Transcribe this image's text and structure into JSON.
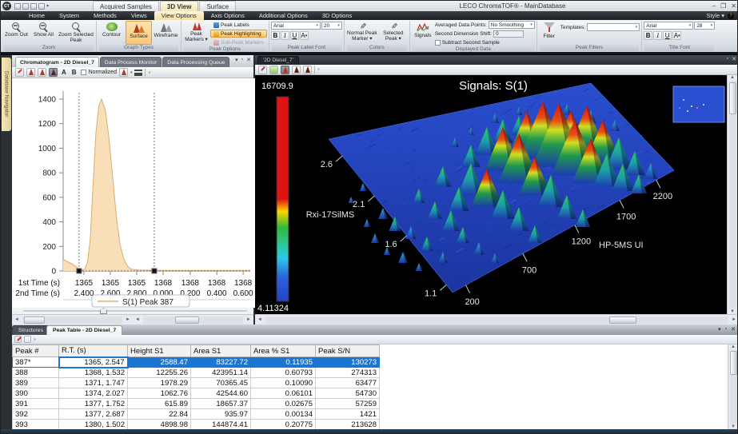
{
  "window": {
    "title": "LECO ChromaTOF® - MainDatabase",
    "style_label": "Style",
    "minimize": "–",
    "maximize": "❐",
    "close": "✕",
    "logo": "CT",
    "help": "?"
  },
  "doc_tabs": [
    {
      "label": "Acquired Samples",
      "active": false
    },
    {
      "label": "3D View",
      "active": true
    },
    {
      "label": "Surface",
      "active": false
    }
  ],
  "ribbon_tabs": [
    {
      "label": "Home",
      "active": false
    },
    {
      "label": "System",
      "active": false
    },
    {
      "label": "Methods",
      "active": false
    },
    {
      "label": "Views",
      "active": false
    },
    {
      "label": "View Options",
      "active": true
    },
    {
      "label": "Axis Options",
      "active": false
    },
    {
      "label": "Additional Options",
      "active": false
    },
    {
      "label": "3D Options",
      "active": false
    }
  ],
  "ribbon": {
    "zoom": {
      "caption": "Zoom",
      "buttons": [
        {
          "label": "Zoom Out"
        },
        {
          "label": "Show All"
        },
        {
          "label": "Zoom Selected Peak"
        }
      ]
    },
    "graph_types": {
      "caption": "Graph Types",
      "buttons": [
        {
          "label": "Contour",
          "active": false
        },
        {
          "label": "Surface",
          "active": true
        },
        {
          "label": "Wireframe",
          "active": false
        }
      ]
    },
    "peak_options": {
      "caption": "Peak Options",
      "marker_label": "Peak Markers",
      "toggles": [
        {
          "label": "Peak Labels",
          "state": "normal"
        },
        {
          "label": "Peak Highlighting",
          "state": "active"
        },
        {
          "label": "Sub-Peak Markers",
          "state": "disabled"
        }
      ]
    },
    "peak_label_font": {
      "caption": "Peak Label Font",
      "font": "Arial",
      "size": "20",
      "bold": "B",
      "italic": "I",
      "underline": "U",
      "color": "A"
    },
    "colors": {
      "caption": "Colors",
      "buttons": [
        {
          "label": "Normal Peak Marker"
        },
        {
          "label": "Selected Peak"
        }
      ]
    },
    "displayed_data": {
      "caption": "Displayed Data",
      "signals": "Signals",
      "avg_label": "Averaged Data Points:",
      "avg_value": "No Smoothing",
      "shift_label": "Second Dimension Shift:",
      "shift_value": "0",
      "subtract": "Subtract Second Sample"
    },
    "peak_filters": {
      "caption": "Peak Filters",
      "filter": "Filter",
      "templates_label": "Templates:",
      "templates_value": ""
    },
    "title_font": {
      "caption": "Title Font",
      "font": "Arial",
      "size": "28",
      "bold": "B",
      "italic": "I",
      "underline": "U",
      "color": "A"
    }
  },
  "left_rail": {
    "tab": "Database Navigator"
  },
  "chromatogram": {
    "tabs": [
      {
        "label": "Chromatogram - 2D Diesel_7",
        "active": true
      },
      {
        "label": "Data Process Monitor",
        "active": false
      },
      {
        "label": "Data Processing Queue",
        "active": false
      }
    ],
    "toolbar": {
      "a": "A",
      "b": "B",
      "normalized": "Normalized"
    },
    "chart_data": {
      "type": "area",
      "legend": "S(1) Peak 387",
      "ylim": [
        0,
        1500
      ],
      "yticks": [
        0,
        200,
        400,
        600,
        800,
        1000,
        1200,
        1400
      ],
      "x_row1_label": "1st Time (s)",
      "x_row2_label": "2nd Time (s)",
      "x_row1_ticks": [
        "1365",
        "1365",
        "1365",
        "1368",
        "1368",
        "1368",
        "1368"
      ],
      "x_row2_ticks": [
        "2.400",
        "2.600",
        "2.800",
        "0.000",
        "0.200",
        "0.400",
        "0.600"
      ],
      "tick_fracs": [
        0.111,
        0.252,
        0.393,
        0.534,
        0.679,
        0.821,
        0.962
      ],
      "curve": [
        [
          0,
          95
        ],
        [
          0.02,
          78
        ],
        [
          0.05,
          55
        ],
        [
          0.07,
          34
        ],
        [
          0.085,
          14
        ],
        [
          0.1,
          7
        ],
        [
          0.115,
          14
        ],
        [
          0.13,
          70
        ],
        [
          0.145,
          260
        ],
        [
          0.16,
          700
        ],
        [
          0.175,
          1120
        ],
        [
          0.19,
          1340
        ],
        [
          0.205,
          1400
        ],
        [
          0.225,
          1310
        ],
        [
          0.245,
          1080
        ],
        [
          0.265,
          760
        ],
        [
          0.285,
          430
        ],
        [
          0.305,
          205
        ],
        [
          0.325,
          92
        ],
        [
          0.345,
          36
        ],
        [
          0.365,
          14
        ],
        [
          0.4,
          7
        ],
        [
          0.487,
          6
        ],
        [
          0.6,
          4
        ],
        [
          0.8,
          4
        ],
        [
          1,
          5
        ]
      ],
      "marker_fracs": [
        0.085,
        0.487
      ],
      "fill_color": "#f8dfb8",
      "line_color": "#dcab70"
    }
  },
  "surface": {
    "tab": "'2D Diesel_7'",
    "chart_data": {
      "type": "surface",
      "title": "Signals: S(1)",
      "colorbar": {
        "max": "16709.9",
        "min": "4.11324"
      },
      "axis_left": {
        "label": "Rxi-17SilMS",
        "ticks": [
          "2.6",
          "2.1",
          "1.6",
          "1.1"
        ]
      },
      "axis_right": {
        "label": "HP-5MS UI",
        "ticks": [
          "200",
          "700",
          "1200",
          "1700",
          "2200"
        ]
      },
      "peaks": [
        [
          150,
          210,
          12,
          "t"
        ],
        [
          165,
          225,
          10,
          "t"
        ],
        [
          185,
          235,
          14,
          "t"
        ],
        [
          205,
          245,
          10,
          "t"
        ],
        [
          140,
          190,
          10,
          "t"
        ],
        [
          160,
          180,
          14,
          "t"
        ],
        [
          175,
          195,
          18,
          "g"
        ],
        [
          195,
          205,
          16,
          "t"
        ],
        [
          215,
          220,
          18,
          "g"
        ],
        [
          235,
          235,
          14,
          "t"
        ],
        [
          120,
          160,
          8,
          "t"
        ],
        [
          135,
          145,
          10,
          "t"
        ],
        [
          225,
          180,
          22,
          "g"
        ],
        [
          245,
          195,
          26,
          "g"
        ],
        [
          260,
          210,
          20,
          "g"
        ],
        [
          280,
          225,
          16,
          "t"
        ],
        [
          205,
          160,
          18,
          "g"
        ],
        [
          255,
          170,
          30,
          "g"
        ],
        [
          300,
          235,
          12,
          "t"
        ],
        [
          270,
          150,
          40,
          "g"
        ],
        [
          290,
          165,
          48,
          "r"
        ],
        [
          310,
          180,
          36,
          "g"
        ],
        [
          330,
          195,
          30,
          "g"
        ],
        [
          350,
          210,
          22,
          "g"
        ],
        [
          235,
          140,
          26,
          "g"
        ],
        [
          310,
          120,
          55,
          "r"
        ],
        [
          330,
          135,
          62,
          "r"
        ],
        [
          350,
          150,
          48,
          "r"
        ],
        [
          370,
          165,
          40,
          "g"
        ],
        [
          390,
          180,
          30,
          "g"
        ],
        [
          410,
          190,
          22,
          "g"
        ],
        [
          340,
          95,
          50,
          "r"
        ],
        [
          360,
          105,
          72,
          "r"
        ],
        [
          380,
          115,
          80,
          "r"
        ],
        [
          400,
          125,
          70,
          "r"
        ],
        [
          420,
          135,
          56,
          "r"
        ],
        [
          440,
          140,
          42,
          "g"
        ],
        [
          460,
          145,
          34,
          "g"
        ],
        [
          480,
          148,
          24,
          "g"
        ],
        [
          395,
          90,
          46,
          "r"
        ],
        [
          415,
          100,
          62,
          "r"
        ],
        [
          435,
          110,
          54,
          "r"
        ],
        [
          455,
          118,
          40,
          "g"
        ],
        [
          475,
          125,
          30,
          "g"
        ],
        [
          495,
          130,
          20,
          "t"
        ],
        [
          310,
          85,
          30,
          "g"
        ],
        [
          330,
          75,
          24,
          "g"
        ],
        [
          290,
          100,
          35,
          "g"
        ],
        [
          270,
          115,
          28,
          "g"
        ],
        [
          250,
          90,
          12,
          "t"
        ],
        [
          270,
          75,
          10,
          "t"
        ],
        [
          300,
          60,
          12,
          "t"
        ],
        [
          330,
          50,
          10,
          "t"
        ],
        [
          360,
          45,
          12,
          "t"
        ],
        [
          390,
          50,
          14,
          "t"
        ],
        [
          420,
          60,
          16,
          "t"
        ],
        [
          450,
          70,
          14,
          "t"
        ]
      ]
    }
  },
  "peak_table": {
    "tabs": [
      {
        "label": "Structures",
        "active": false
      },
      {
        "label": "Peak Table - 2D Diesel_7",
        "active": true
      }
    ],
    "chart_data": {
      "type": "table",
      "columns": [
        "Peak #",
        "R.T. (s)",
        "Height S1",
        "Area S1",
        "Area % S1",
        "Peak S/N"
      ],
      "rows": [
        [
          "387*",
          "1365, 2.547",
          "2588.47",
          "83227.72",
          "0.11935",
          "130273"
        ],
        [
          "388",
          "1368, 1.532",
          "12255.26",
          "423951.14",
          "0.60793",
          "274313"
        ],
        [
          "389",
          "1371, 1.747",
          "1978.29",
          "70365.45",
          "0.10090",
          "63477"
        ],
        [
          "390",
          "1374, 2.027",
          "1062.76",
          "42544.60",
          "0.06101",
          "54730"
        ],
        [
          "391",
          "1377, 1.752",
          "615.89",
          "18657.37",
          "0.02675",
          "57259"
        ],
        [
          "392",
          "1377, 2.687",
          "22.84",
          "935.97",
          "0.00134",
          "1421"
        ],
        [
          "393",
          "1380, 1.502",
          "4898.98",
          "144874.41",
          "0.20775",
          "213628"
        ]
      ],
      "selected_row": 0
    }
  }
}
